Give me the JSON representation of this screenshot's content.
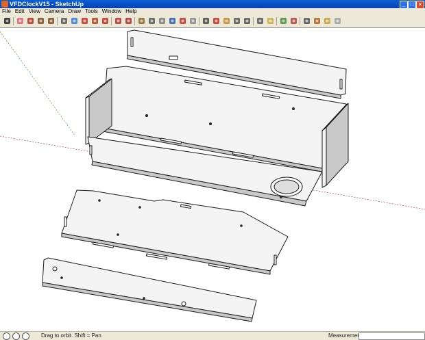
{
  "window": {
    "title": "VFDClockV15 - SketchUp"
  },
  "menu": [
    "File",
    "Edit",
    "View",
    "Camera",
    "Draw",
    "Tools",
    "Window",
    "Help"
  ],
  "toolbar": [
    {
      "name": "select-tool-icon",
      "color": "#222"
    },
    {
      "name": "eraser-tool-icon",
      "color": "#e0607a"
    },
    {
      "name": "pencil-line-tool-icon",
      "color": "#b03020"
    },
    {
      "name": "rectangle-tool-icon",
      "color": "#7a4a20"
    },
    {
      "name": "circle-tool-icon",
      "color": "#7a4a20"
    },
    {
      "name": "arc-tool-icon",
      "color": "#555"
    },
    {
      "name": "paint-bucket-icon",
      "color": "#3a7ad8"
    },
    {
      "name": "push-pull-icon",
      "color": "#c0302a"
    },
    {
      "name": "move-tool-icon",
      "color": "#b04020"
    },
    {
      "name": "rotate-tool-icon",
      "color": "#c03020"
    },
    {
      "name": "follow-me-icon",
      "color": "#b03030"
    },
    {
      "name": "offset-tool-icon",
      "color": "#a83030"
    },
    {
      "name": "scale-tool-icon",
      "color": "#8a6a2a"
    },
    {
      "name": "tape-measure-icon",
      "color": "#555"
    },
    {
      "name": "protractor-icon",
      "color": "#7a7a7a"
    },
    {
      "name": "text-tool-icon",
      "color": "#2a5ab0"
    },
    {
      "name": "axes-tool-icon",
      "color": "#c03030"
    },
    {
      "name": "dimension-tool-icon",
      "color": "#888"
    },
    {
      "name": "3d-text-icon",
      "color": "#444"
    },
    {
      "name": "orbit-tool-icon",
      "color": "#c03020"
    },
    {
      "name": "pan-tool-icon",
      "color": "#c28a2a"
    },
    {
      "name": "zoom-tool-icon",
      "color": "#555"
    },
    {
      "name": "zoom-window-icon",
      "color": "#555"
    },
    {
      "name": "zoom-extents-icon",
      "color": "#555"
    },
    {
      "name": "get-models-icon",
      "color": "#c8b040"
    },
    {
      "name": "share-model-icon",
      "color": "#4a8a3a"
    },
    {
      "name": "walk-tool-icon",
      "color": "#b04040"
    },
    {
      "name": "look-around-icon",
      "color": "#555"
    },
    {
      "name": "position-camera-icon",
      "color": "#b06020"
    },
    {
      "name": "section-plane-icon",
      "color": "#c8a040"
    },
    {
      "name": "components-icon",
      "color": "#a0a0a0"
    }
  ],
  "status": {
    "hint": "Drag to orbit.  Shift = Pan",
    "measurements_label": "Measurements",
    "measurements_value": ""
  },
  "colors": {
    "panel_fill": "#f4f4f4",
    "panel_shade": "#c9c9c9",
    "edge": "#1a1a1a"
  }
}
